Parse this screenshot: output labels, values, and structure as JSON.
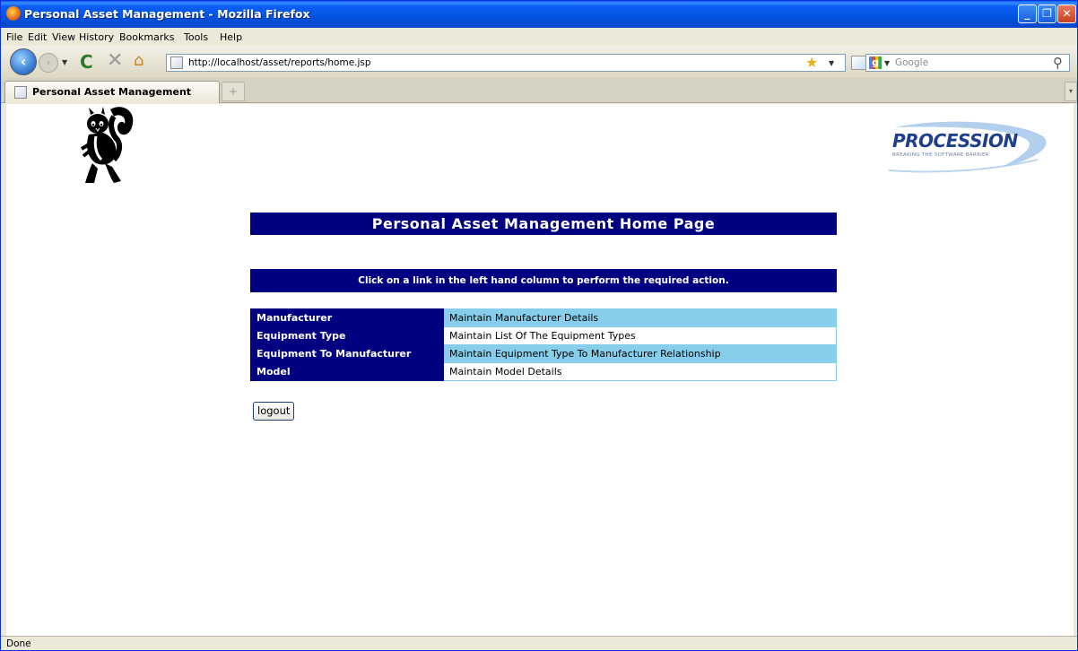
{
  "window": {
    "title": "Personal Asset Management - Mozilla Firefox",
    "min": "_",
    "max": "❐",
    "close": "✕"
  },
  "menu": {
    "items": [
      "File",
      "Edit",
      "View",
      "History",
      "Bookmarks",
      "Tools",
      "Help"
    ]
  },
  "nav": {
    "url": "http://localhost/asset/reports/home.jsp",
    "search_placeholder": "Google"
  },
  "tab": {
    "label": "Personal Asset Management",
    "new_tab": "+"
  },
  "logo": {
    "brand": "PROCESSION",
    "tagline": "BREAKING THE SOFTWARE BARRIER"
  },
  "page": {
    "heading": "Personal Asset Management Home Page",
    "instruction": "Click on a link in the left hand column to perform the required action.",
    "rows": [
      {
        "link": "Manufacturer",
        "description": "Maintain Manufacturer Details"
      },
      {
        "link": "Equipment Type",
        "description": "Maintain List Of The Equipment Types"
      },
      {
        "link": "Equipment To Manufacturer",
        "description": "Maintain Equipment Type To Manufacturer Relationship"
      },
      {
        "link": "Model",
        "description": "Maintain Model Details"
      }
    ],
    "logout_label": "logout"
  },
  "status": {
    "text": "Done"
  },
  "colors": {
    "banner": "#000080",
    "row_highlight": "#87ceeb",
    "title_bar": "#0a5ef7"
  }
}
